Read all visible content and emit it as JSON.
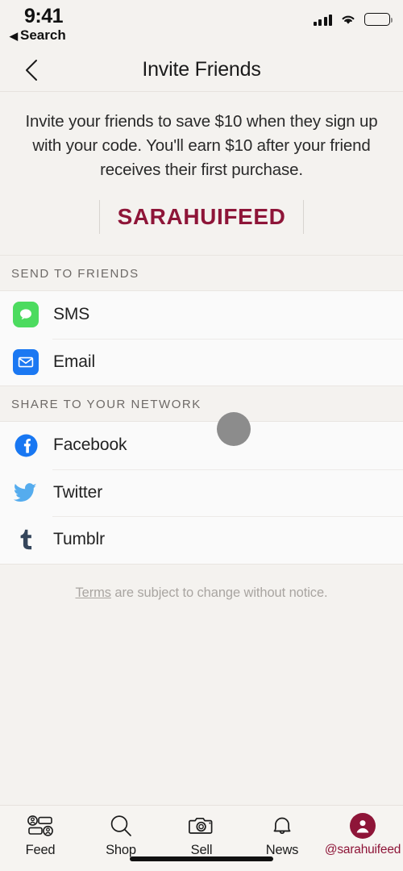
{
  "status_bar": {
    "time": "9:41",
    "back_to_app": "Search",
    "back_triangle": "◀",
    "signal_icon": "signal-bars-icon",
    "wifi_icon": "wifi-icon",
    "battery_icon": "battery-full-icon"
  },
  "header": {
    "back_icon": "chevron-left-icon",
    "title": "Invite Friends"
  },
  "promo": {
    "description": "Invite your friends to save $10 when they sign up with your code. You'll earn $10 after your friend receives their first purchase.",
    "referral_code": "SARAHUIFEED",
    "code_color": "#8e1538"
  },
  "sections": [
    {
      "title": "SEND TO FRIENDS",
      "rows": [
        {
          "label": "SMS",
          "icon": "sms-message-icon",
          "icon_color": "#4cdb5f"
        },
        {
          "label": "Email",
          "icon": "email-envelope-icon",
          "icon_color": "#1b78f2"
        }
      ]
    },
    {
      "title": "SHARE TO YOUR NETWORK",
      "rows": [
        {
          "label": "Facebook",
          "icon": "facebook-icon",
          "icon_color": "#1877f2"
        },
        {
          "label": "Twitter",
          "icon": "twitter-bird-icon",
          "icon_color": "#55acee"
        },
        {
          "label": "Tumblr",
          "icon": "tumblr-icon",
          "icon_color": "#35465c"
        }
      ]
    }
  ],
  "terms": {
    "link_text": "Terms",
    "rest_text": " are subject to change without notice."
  },
  "tab_bar": {
    "items": [
      {
        "label": "Feed",
        "icon": "feed-icon",
        "active": false
      },
      {
        "label": "Shop",
        "icon": "search-magnifier-icon",
        "active": false
      },
      {
        "label": "Sell",
        "icon": "camera-icon",
        "active": false
      },
      {
        "label": "News",
        "icon": "bell-icon",
        "active": false
      },
      {
        "label": "@sarahuifeed",
        "icon": "profile-avatar-icon",
        "active": true
      }
    ]
  },
  "overlay": {
    "touch_indicator": "touch-point-indicator"
  },
  "home_indicator": "home-indicator-bar"
}
